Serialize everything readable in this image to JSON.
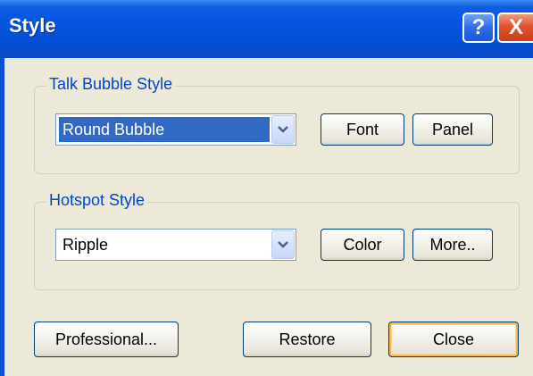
{
  "window": {
    "title": "Style",
    "help_label": "?",
    "close_label": "X"
  },
  "talk_bubble": {
    "legend": "Talk Bubble Style",
    "selected_value": "Round Bubble",
    "font_button": "Font",
    "panel_button": "Panel"
  },
  "hotspot": {
    "legend": "Hotspot Style",
    "selected_value": "Ripple",
    "color_button": "Color",
    "more_button": "More.."
  },
  "footer": {
    "professional_button": "Professional...",
    "restore_button": "Restore",
    "close_button": "Close"
  },
  "colors": {
    "title_bar": "#0554e0",
    "legend_text": "#0046d5",
    "selection": "#316ac5",
    "dialog_bg": "#ece9d8"
  },
  "icons": {
    "dropdown": "chevron-down-icon",
    "help": "question-mark-icon",
    "close": "close-x-icon"
  }
}
